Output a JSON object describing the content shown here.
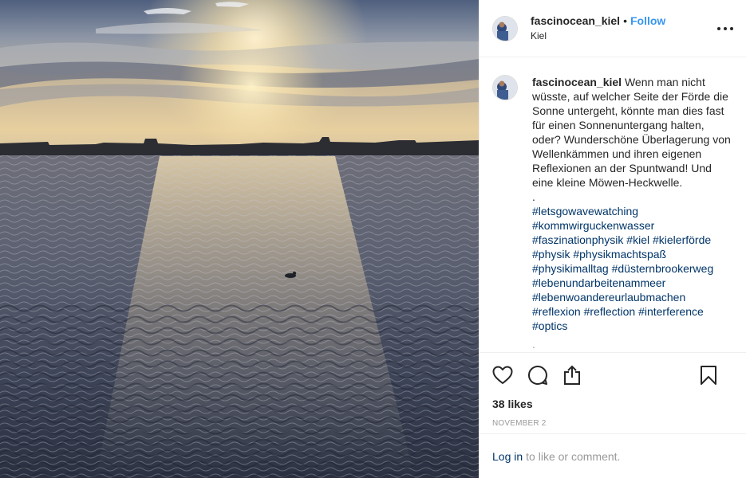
{
  "post": {
    "username": "fascinocean_kiel",
    "separator": "•",
    "follow_label": "Follow",
    "location": "Kiel",
    "more_icon": "more-horizontal-icon"
  },
  "caption": {
    "username": "fascinocean_kiel",
    "text": "Wenn man nicht wüsste, auf welcher Seite der Förde die Sonne untergeht, könnte man dies fast für einen Sonnenuntergang halten, oder? Wunderschöne Überlagerung von Wellenkämmen und ihren eigenen Reflexionen an der Spuntwand! Und eine kleine Möwen-Heckwelle.",
    "dot_line": ".",
    "hashtags": [
      "#letsgowavewatching",
      "#kommwirguckenwasser",
      "#faszinationphysik",
      "#kiel",
      "#kielerförde",
      "#physik",
      "#physikmachtspaß",
      "#physikimalltag",
      "#düsternbrookerweg",
      "#lebenundarbeitenammeer",
      "#lebenwoandereurlaubmachen",
      "#reflexion",
      "#reflection",
      "#interference",
      "#optics"
    ],
    "overflow_dot": "."
  },
  "actions": {
    "like_icon": "heart-icon",
    "comment_icon": "comment-icon",
    "share_icon": "share-icon",
    "save_icon": "bookmark-icon"
  },
  "likes": "38 likes",
  "date": "NOVEMBER 2",
  "login": {
    "link": "Log in",
    "rest": "to like or comment."
  },
  "colors": {
    "link_blue": "#3897f0",
    "hashtag": "#003569",
    "muted": "#999999",
    "text": "#262626"
  }
}
